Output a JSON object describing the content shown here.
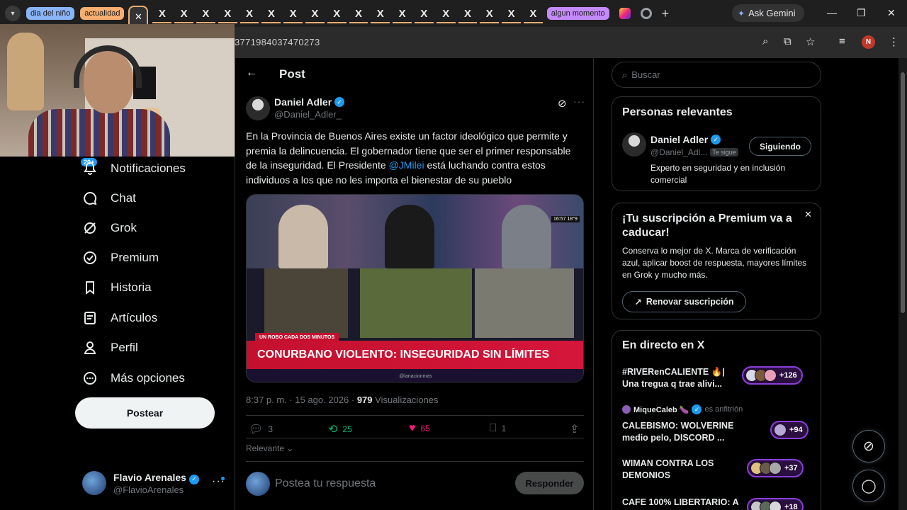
{
  "browser": {
    "tab_groups": {
      "g1": "dia del niño",
      "g2": "actualidad",
      "g3": "algun momento"
    },
    "x_tabs": [
      "X",
      "X",
      "X",
      "X",
      "X",
      "X",
      "X",
      "X",
      "X",
      "X",
      "X",
      "X",
      "X",
      "X",
      "X",
      "X",
      "X",
      "X"
    ],
    "active_tab_close": "✕",
    "new_tab": "+",
    "gemini": "Ask Gemini",
    "url": "3771984037470273",
    "profile_initial": "N"
  },
  "nav": {
    "badge": "20+",
    "items": [
      "Notificaciones",
      "Chat",
      "Grok",
      "Premium",
      "Historia",
      "Artículos",
      "Perfil",
      "Más opciones"
    ],
    "post_button": "Postear"
  },
  "me": {
    "name": "Flavio Arenales",
    "handle": "@FlavioArenales"
  },
  "main": {
    "header": "Post",
    "author_name": "Daniel Adler",
    "author_handle": "@Daniel_Adler_",
    "text_1": "En la Provincia de Buenos Aires existe un factor ideológico que permite y premia la delincuencia. El gobernador tiene que ser el primer responsable de la inseguridad. El Presidente ",
    "mention": "@JMilei",
    "text_2": " está luchando contra estos individuos a los que no les importa el bienestar de su pueblo",
    "media_tag": "UN ROBO CADA DOS MINUTOS",
    "media_headline": "CONURBANO VIOLENTO: INSEGURIDAD SIN LÍMITES",
    "media_ticker": "@lanacionmas",
    "media_clock": "16:57  18°9",
    "time": "8:37 p. m. · 15 ago. 2026 · ",
    "views_count": "979",
    "views_label": " Visualizaciones",
    "replies": "3",
    "reposts": "25",
    "likes": "65",
    "bookmarks": "1",
    "sort": "Relevante",
    "reply_placeholder": "Postea tu respuesta",
    "reply_button": "Responder"
  },
  "sidebar": {
    "search_placeholder": "Buscar",
    "relevant_title": "Personas relevantes",
    "rel_name": "Daniel Adler",
    "rel_handle": "@Daniel_Adl...",
    "rel_tag": "Te sigue",
    "rel_follow": "Siguiendo",
    "rel_bio": "Experto en seguridad y en inclusión comercial",
    "premium_title": "¡Tu suscripción a Premium va a caducar!",
    "premium_body": "Conserva lo mejor de X. Marca de verificación azul, aplicar boost de respuesta, mayores límites en Grok y mucho más.",
    "premium_button": "Renovar suscripción",
    "live_title": "En directo en X",
    "live": [
      {
        "title": "#RIVERenCALIENTE 🔥| Una tregua q trae alivi...",
        "count": "+126"
      },
      {
        "host": "MiqueCaleb 🍆",
        "host_suffix": "es anfitrión",
        "title": "CALEBISMO: WOLVERINE medio pelo, DISCORD ...",
        "count": "+94"
      },
      {
        "title": "WIMAN CONTRA LOS DEMONIOS",
        "count": "+37"
      },
      {
        "title": "CAFE 100% LIBERTARIO: A",
        "count": "+18"
      }
    ]
  },
  "colors": {
    "accent": "#1d9bf0",
    "like": "#f91880",
    "repost": "#00ba7c",
    "live": "#8b3fd9"
  }
}
